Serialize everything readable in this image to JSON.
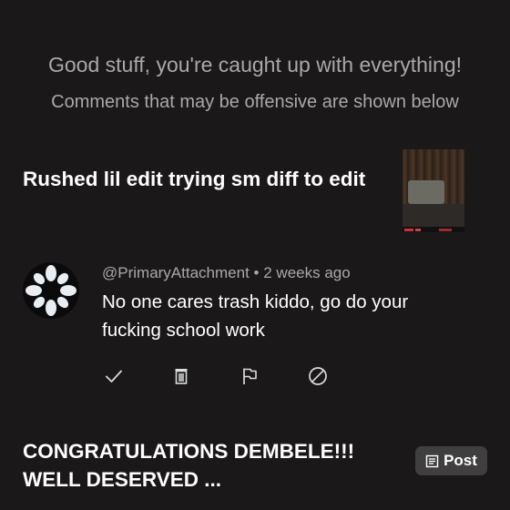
{
  "notice": {
    "caught_up": "Good stuff, you're caught up with everything!",
    "offensive": "Comments that may be offensive are shown below"
  },
  "video": {
    "title": "Rushed lil edit trying sm diff to edit",
    "thumbnail_icon": "video-thumbnail"
  },
  "comment": {
    "author": "@PrimaryAttachment",
    "separator": "•",
    "time": "2 weeks ago",
    "text": "No one cares trash kiddo, go do your fucking school work",
    "actions": [
      "check-icon",
      "trash-icon",
      "flag-icon",
      "block-icon"
    ]
  },
  "next_item": {
    "title": "CONGRATULATIONS DEMBELE!!! WELL DESERVED ...",
    "post_label": "Post",
    "post_icon": "post-icon"
  },
  "colors": {
    "background": "#1a1818",
    "secondary_text": "#a9a9a9",
    "button_bg": "#3f3f3f"
  }
}
